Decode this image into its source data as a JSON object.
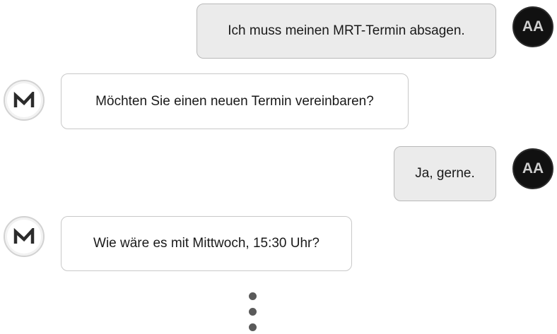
{
  "conversation": {
    "messages": [
      {
        "sender": "user",
        "avatar_initials": "AA",
        "text": "Ich muss meinen MRT-Termin absagen."
      },
      {
        "sender": "bot",
        "avatar_icon": "m-logo-icon",
        "text": "Möchten Sie einen neuen Termin vereinbaren?"
      },
      {
        "sender": "user",
        "avatar_initials": "AA",
        "text": "Ja, gerne."
      },
      {
        "sender": "bot",
        "avatar_icon": "m-logo-icon",
        "text": "Wie wäre es mit Mittwoch, 15:30 Uhr?"
      }
    ],
    "continuation_indicator_icon": "vertical-ellipsis-icon"
  },
  "colors": {
    "user_bubble_bg": "#ebebeb",
    "user_avatar_bg": "#111111",
    "bot_logo": "#2b2b2b",
    "dots": "#5a5a5a"
  }
}
